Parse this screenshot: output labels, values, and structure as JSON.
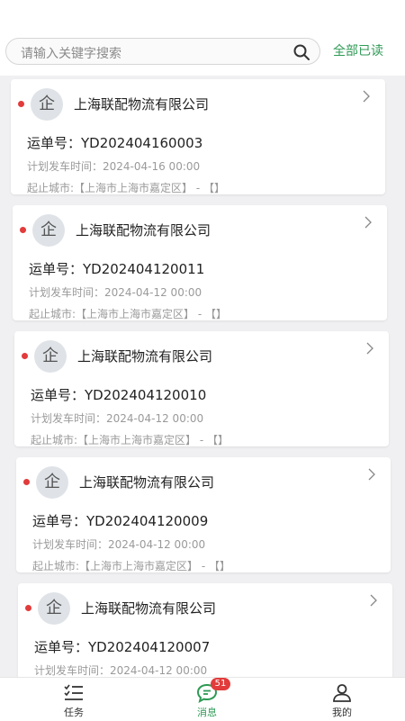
{
  "search": {
    "placeholder": "请输入关键字搜索",
    "read_all": "全部已读"
  },
  "messages": [
    {
      "avatar": "企",
      "company": "上海联配物流有限公司",
      "waybill": "运单号：YD202404160003",
      "departure": "计划发车时间：2024-04-16 00:00",
      "cities": "起止城市:【上海市上海市嘉定区】 - 【】",
      "unread": true
    },
    {
      "avatar": "企",
      "company": "上海联配物流有限公司",
      "waybill": "运单号：YD202404120011",
      "departure": "计划发车时间：2024-04-12 00:00",
      "cities": "起止城市:【上海市上海市嘉定区】 - 【】",
      "unread": true
    },
    {
      "avatar": "企",
      "company": "上海联配物流有限公司",
      "waybill": "运单号：YD202404120010",
      "departure": "计划发车时间：2024-04-12 00:00",
      "cities": "起止城市:【上海市上海市嘉定区】 - 【】",
      "unread": true
    },
    {
      "avatar": "企",
      "company": "上海联配物流有限公司",
      "waybill": "运单号：YD202404120009",
      "departure": "计划发车时间：2024-04-12 00:00",
      "cities": "起止城市:【上海市上海市嘉定区】 - 【】",
      "unread": true
    },
    {
      "avatar": "企",
      "company": "上海联配物流有限公司",
      "waybill": "运单号：YD202404120007",
      "departure": "计划发车时间：2024-04-12 00:00",
      "cities": "",
      "unread": true
    }
  ],
  "tabbar": {
    "tasks": {
      "label": "任务",
      "icon": "task-list-icon"
    },
    "messages": {
      "label": "消息",
      "icon": "message-icon",
      "badge": "51"
    },
    "profile": {
      "label": "我的",
      "icon": "user-icon"
    }
  },
  "colors": {
    "accent": "#2e9a55",
    "unread": "#e23b3b"
  }
}
